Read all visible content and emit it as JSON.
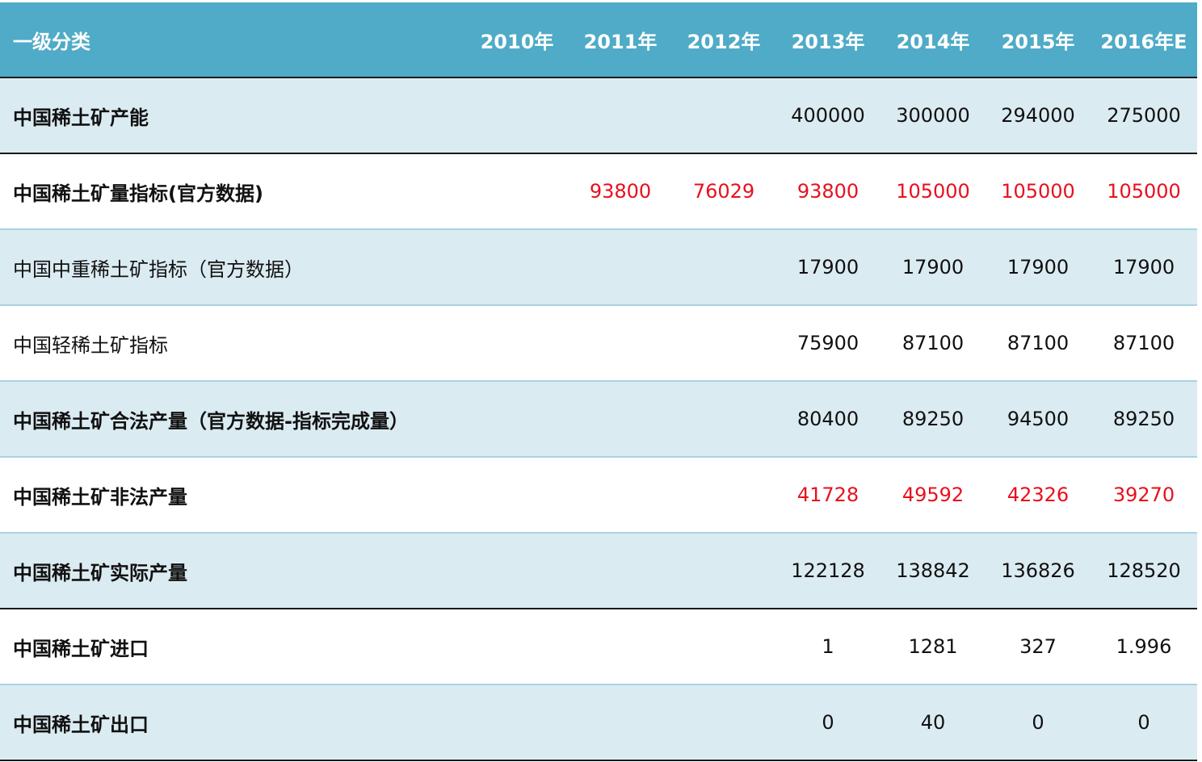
{
  "colors": {
    "header_bg": "#4fabc7",
    "row_tinted": "#dbebf2",
    "row_plain": "#ffffff",
    "row_separator": "#a9d3e1",
    "section_separator": "#1a1a1a",
    "highlight_text": "#e8101d",
    "header_text": "#ffffff"
  },
  "chart_data": {
    "type": "table",
    "columns": [
      "一级分类",
      "2010年",
      "2011年",
      "2012年",
      "2013年",
      "2014年",
      "2015年",
      "2016年E"
    ],
    "rows": [
      {
        "label": "中国稀土矿产能",
        "bold": true,
        "highlight": false,
        "values": [
          "",
          "",
          "",
          "400000",
          "300000",
          "294000",
          "275000"
        ]
      },
      {
        "label": "中国稀土矿量指标(官方数据)",
        "bold": true,
        "highlight": true,
        "values": [
          "",
          "93800",
          "76029",
          "93800",
          "105000",
          "105000",
          "105000"
        ]
      },
      {
        "label": "中国中重稀土矿指标（官方数据）",
        "bold": false,
        "highlight": false,
        "values": [
          "",
          "",
          "",
          "17900",
          "17900",
          "17900",
          "17900"
        ]
      },
      {
        "label": "中国轻稀土矿指标",
        "bold": false,
        "highlight": false,
        "values": [
          "",
          "",
          "",
          "75900",
          "87100",
          "87100",
          "87100"
        ]
      },
      {
        "label": "中国稀土矿合法产量（官方数据-指标完成量）",
        "bold": true,
        "highlight": false,
        "values": [
          "",
          "",
          "",
          "80400",
          "89250",
          "94500",
          "89250"
        ]
      },
      {
        "label": "中国稀土矿非法产量",
        "bold": true,
        "highlight": true,
        "values": [
          "",
          "",
          "",
          "41728",
          "49592",
          "42326",
          "39270"
        ]
      },
      {
        "label": "中国稀土矿实际产量",
        "bold": true,
        "highlight": false,
        "values": [
          "",
          "",
          "",
          "122128",
          "138842",
          "136826",
          "128520"
        ]
      },
      {
        "label": "中国稀土矿进口",
        "bold": true,
        "highlight": false,
        "values": [
          "",
          "",
          "",
          "1",
          "1281",
          "327",
          "1.996"
        ]
      },
      {
        "label": "中国稀土矿出口",
        "bold": true,
        "highlight": false,
        "values": [
          "",
          "",
          "",
          "0",
          "40",
          "0",
          "0"
        ]
      }
    ]
  }
}
